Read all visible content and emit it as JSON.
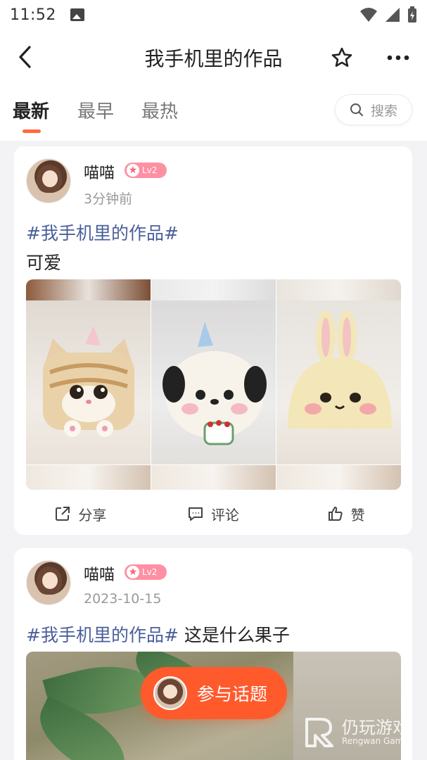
{
  "status_bar": {
    "time": "11:52"
  },
  "header": {
    "title": "我手机里的作品"
  },
  "tabs": [
    {
      "label": "最新",
      "active": true
    },
    {
      "label": "最早",
      "active": false
    },
    {
      "label": "最热",
      "active": false
    }
  ],
  "search": {
    "label": "搜索"
  },
  "posts": [
    {
      "username": "喵喵",
      "level": "Lv2",
      "time": "3分钟前",
      "tag": "#我手机里的作品#",
      "text": "可爱",
      "actions": {
        "share": "分享",
        "comment": "评论",
        "like": "赞"
      }
    },
    {
      "username": "喵喵",
      "level": "Lv2",
      "time": "2023-10-15",
      "tag": "#我手机里的作品#",
      "text": " 这是什么果子"
    }
  ],
  "fab": {
    "label": "参与话题"
  },
  "watermark": {
    "title": "仍玩游戏",
    "subtitle": "Rengwan Games"
  },
  "colors": {
    "accent": "#ff5a2c",
    "tag": "#4a5f9a",
    "badge": "#ff8fa3"
  }
}
